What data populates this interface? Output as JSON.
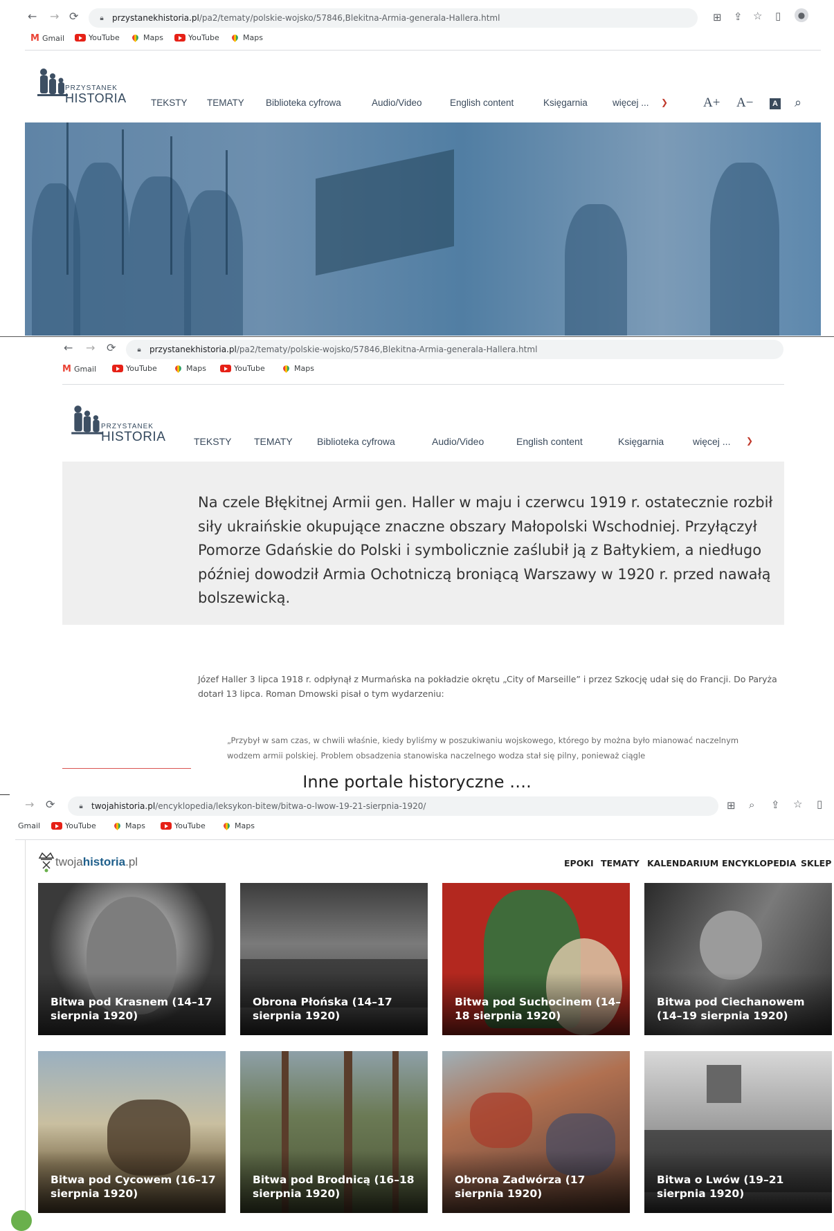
{
  "browser1": {
    "url_host": "przystanekhistoria.pl",
    "url_path": "/pa2/tematy/polskie-wojsko/57846,Blekitna-Armia-generala-Hallera.html",
    "bookmarks": [
      "Gmail",
      "YouTube",
      "Maps",
      "YouTube",
      "Maps"
    ]
  },
  "site1": {
    "logo_small": "PRZYSTANEK",
    "logo_big": "HISTORIA",
    "nav": [
      "TEKSTY",
      "TEMATY",
      "Biblioteka cyfrowa",
      "Audio/Video",
      "English content",
      "Księgarnia",
      "więcej ..."
    ],
    "font_up": "A+",
    "font_down": "A−"
  },
  "browser2": {
    "url_host": "przystanekhistoria.pl",
    "url_path": "/pa2/tematy/polskie-wojsko/57846,Blekitna-Armia-generala-Hallera.html",
    "bookmarks": [
      "Gmail",
      "YouTube",
      "Maps",
      "YouTube",
      "Maps"
    ]
  },
  "article": {
    "lead": "Na czele Błękitnej Armii gen. Haller w maju i czerwcu 1919 r. ostatecznie rozbił siły ukraińskie okupujące znaczne obszary Małopolski Wschodniej. Przyłączył Pomorze Gdańskie do Polski i symbolicznie zaślubił ją z Bałtykiem, a niedługo później dowodził Armia Ochotniczą broniącą Warszawy w 1920 r. przed nawałą bolszewicką.",
    "body": "Józef Haller 3 lipca 1918 r. odpłynął z Murmańska na pokładzie okrętu „City of Marseille” i przez Szkocję udał się do Francji. Do Paryża dotarł 13 lipca. Roman Dmowski pisał o tym wydarzeniu:",
    "quote": "„Przybył w sam czas, w chwili właśnie, kiedy byliśmy w poszukiwaniu wojskowego, którego by można było mianować naczelnym wodzem armii polskiej. Problem obsadzenia stanowiska naczelnego wodza stał się pilny, ponieważ ciągle"
  },
  "caption": "Inne portale historyczne ….",
  "browser3": {
    "url_host": "twojahistoria.pl",
    "url_path": "/encyklopedia/leksykon-bitew/bitwa-o-lwow-19-21-sierpnia-1920/",
    "bookmarks": [
      "Gmail",
      "YouTube",
      "Maps",
      "YouTube",
      "Maps"
    ]
  },
  "site3": {
    "logo_a": "twoja",
    "logo_b": "historia",
    "logo_c": ".pl",
    "nav": [
      "EPOKI",
      "TEMATY",
      "KALENDARIUM",
      "ENCYKLOPEDIA",
      "SKLEP"
    ],
    "cards": [
      {
        "title": "Bitwa pod Krasnem (14–17 sierpnia 1920)",
        "tone": "#6b6b6b"
      },
      {
        "title": "Obrona Płońska (14–17 sierpnia 1920)",
        "tone": "#5a5a5a"
      },
      {
        "title": "Bitwa pod Suchocinem (14–18 sierpnia 1920)",
        "tone": "#b3281f"
      },
      {
        "title": "Bitwa pod Ciechanowem (14–19 sierpnia 1920)",
        "tone": "#4d4d4d"
      },
      {
        "title": "Bitwa pod Cycowem (16–17 sierpnia 1920)",
        "tone": "#8a7a5a"
      },
      {
        "title": "Bitwa pod Brodnicą (16–18 sierpnia 1920)",
        "tone": "#5e6b4a"
      },
      {
        "title": "Obrona Zadwórza (17 sierpnia 1920)",
        "tone": "#8b5a45"
      },
      {
        "title": "Bitwa o Lwów (19–21 sierpnia 1920)",
        "tone": "#5c5c5c"
      }
    ]
  }
}
